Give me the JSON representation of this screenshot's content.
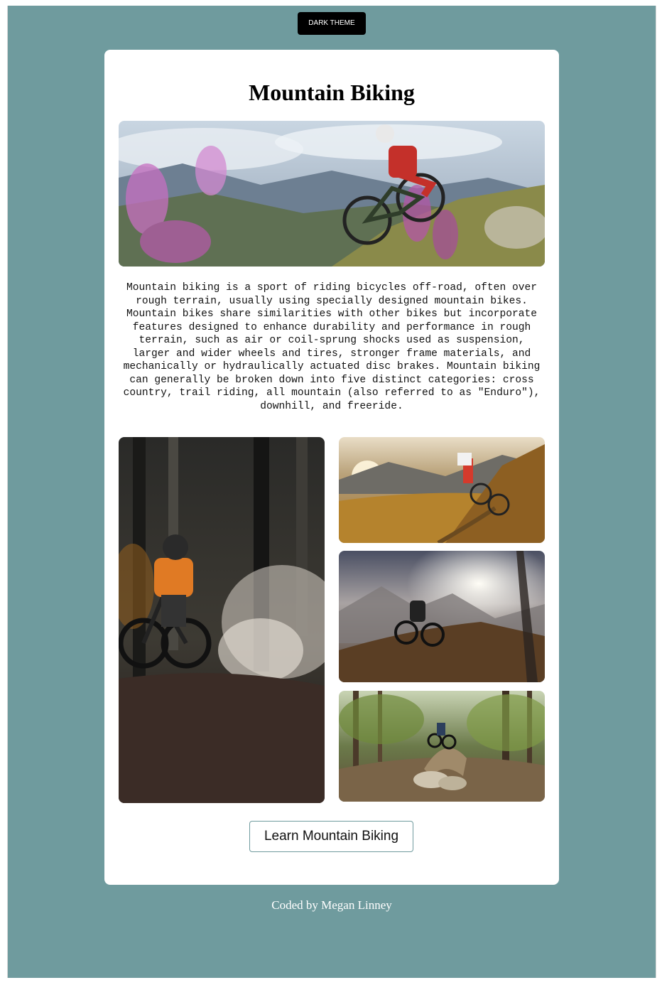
{
  "header": {
    "theme_button_label": "DARK THEME"
  },
  "card": {
    "title": "Mountain Biking",
    "description": "Mountain biking is a sport of riding bicycles off-road, often over rough terrain, usually using specially designed mountain bikes. Mountain bikes share similarities with other bikes but incorporate features designed to enhance durability and performance in rough terrain, such as air or coil-sprung shocks used as suspension, larger and wider wheels and tires, stronger frame materials, and mechanically or hydraulically actuated disc brakes. Mountain biking can generally be broken down into five distinct categories: cross country, trail riding, all mountain (also referred to as \"Enduro\"), downhill, and freeride.",
    "cta_label": "Learn Mountain Biking"
  },
  "footer": {
    "credit": "Coded by Megan Linney"
  },
  "colors": {
    "page_background": "#6f9b9e",
    "card_background": "#ffffff",
    "button_dark": "#000000"
  }
}
